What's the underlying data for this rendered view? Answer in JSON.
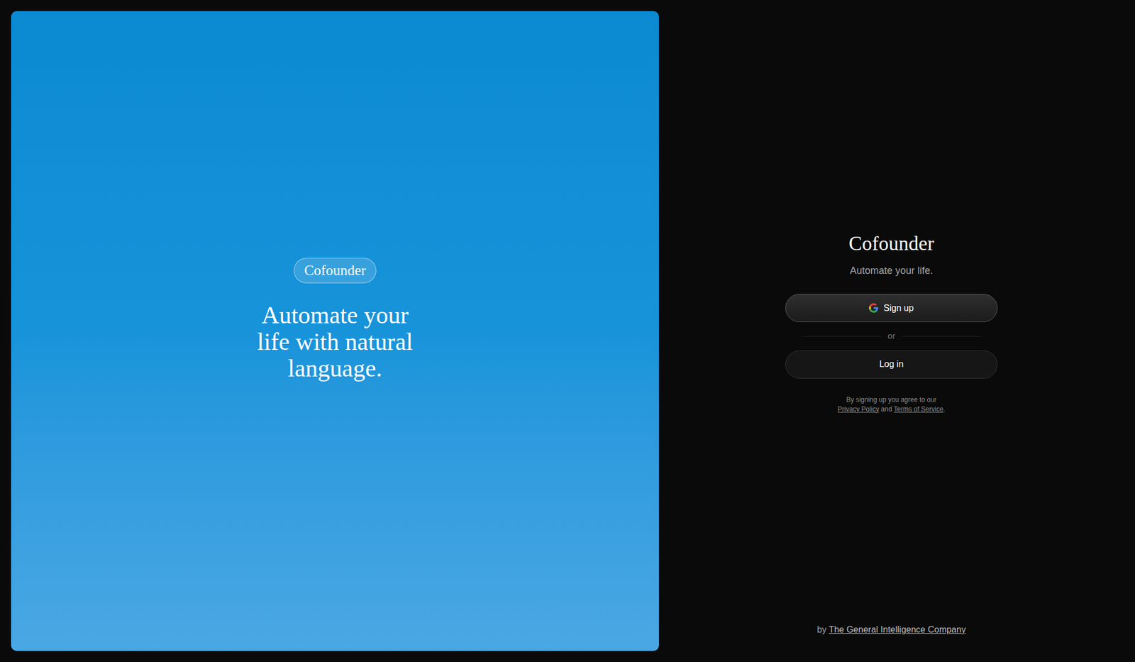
{
  "hero": {
    "badge": "Cofounder",
    "headline": "Automate your life with natural language."
  },
  "auth": {
    "title": "Cofounder",
    "subtitle": "Automate your life.",
    "signup_button": "Sign up",
    "divider": "or",
    "login_button": "Log in",
    "legal": {
      "prefix": "By signing up you agree to our",
      "privacy": "Privacy Policy",
      "and": "and",
      "terms": "Terms of Service",
      "suffix": "."
    }
  },
  "footer": {
    "prefix": "by",
    "company": "The General Intelligence Company"
  }
}
